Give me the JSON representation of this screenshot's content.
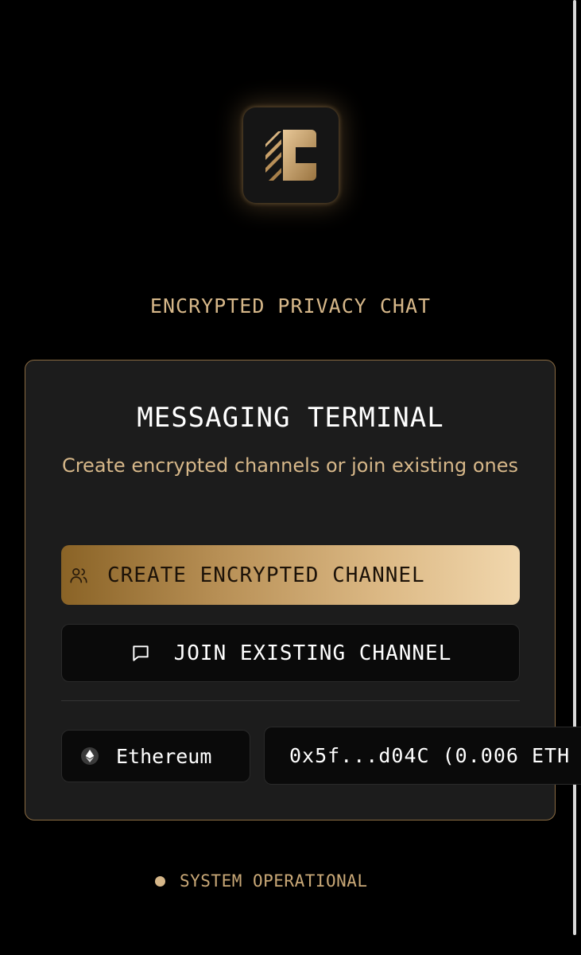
{
  "app": {
    "tagline": "ENCRYPTED PRIVACY CHAT",
    "logo_icon": "stripe-c-logo"
  },
  "card": {
    "title": "MESSAGING TERMINAL",
    "subtitle": "Create encrypted channels or join existing ones",
    "create_button": {
      "label": "CREATE ENCRYPTED CHANNEL",
      "icon": "users-icon"
    },
    "join_button": {
      "label": "JOIN EXISTING CHANNEL",
      "icon": "message-square-icon"
    },
    "network": {
      "label": "Ethereum",
      "icon": "ethereum-icon"
    },
    "wallet": {
      "label": "0x5f...d04C (0.006 ETH"
    }
  },
  "status": {
    "text": "SYSTEM OPERATIONAL"
  },
  "colors": {
    "background": "#000000",
    "accent_gold": "#d6b789",
    "card_border": "#8a6b42",
    "card_bg": "#1c1c1c"
  }
}
